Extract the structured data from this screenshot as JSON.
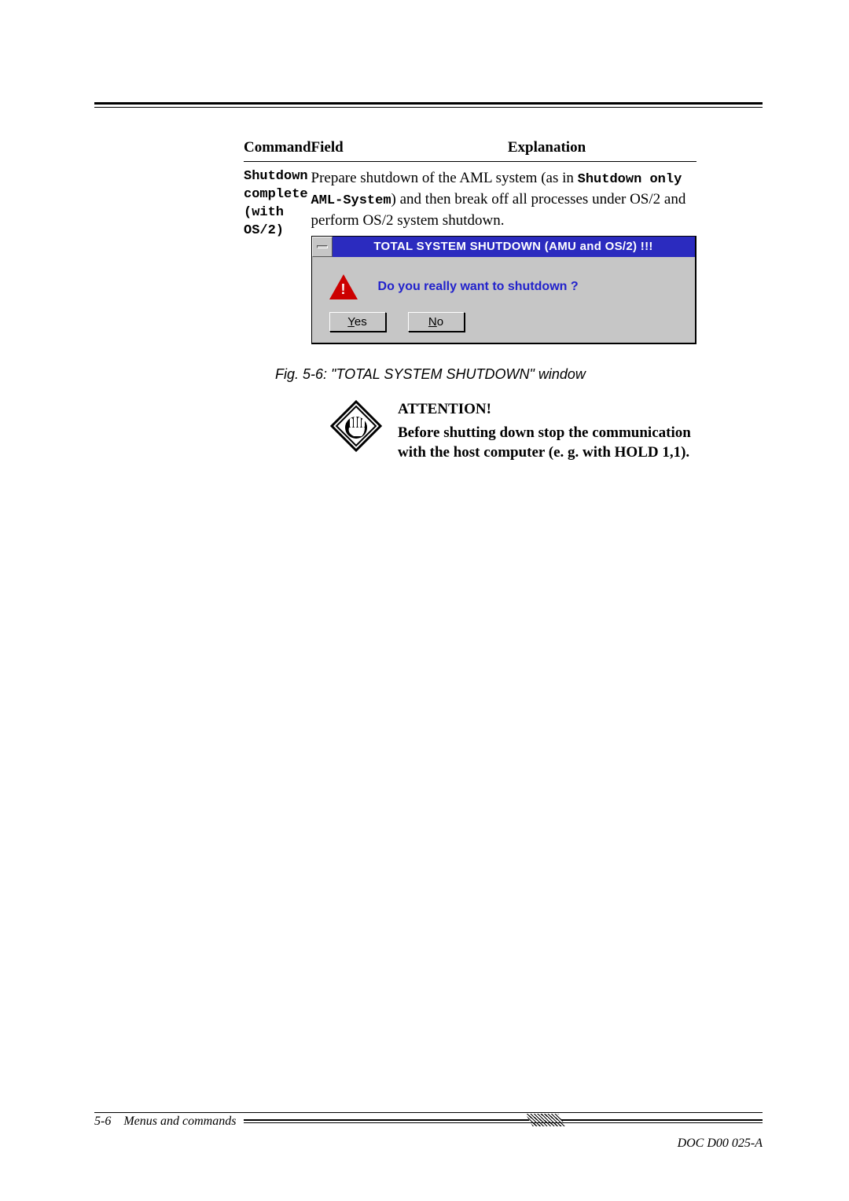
{
  "table": {
    "headers": {
      "command": "Command",
      "field": "Field",
      "explanation": "Explanation"
    },
    "row": {
      "command_l1": "Shutdown",
      "command_l2": "complete",
      "command_l3": "(with OS/2)",
      "explain_pre": "Prepare shutdown of the AML system (as in ",
      "explain_b1": "Shutdown only AML-System",
      "explain_mid": ") and then break off all processes under OS/2 and perform OS/2 system shutdown."
    }
  },
  "dialog": {
    "title": "TOTAL SYSTEM SHUTDOWN (AMU and OS/2) !!!",
    "question": "Do you really want to shutdown ?",
    "yes_u": "Y",
    "yes_rest": "es",
    "no_u": "N",
    "no_rest": "o"
  },
  "caption": "Fig. 5-6: \"TOTAL SYSTEM SHUTDOWN\" window",
  "attention": {
    "heading": "ATTENTION!",
    "body": "Before shutting down stop the communication with the host computer (e. g. with HOLD 1,1)."
  },
  "footer": {
    "page": "5-6",
    "section": "Menus and commands",
    "docid": "DOC D00 025-A"
  }
}
